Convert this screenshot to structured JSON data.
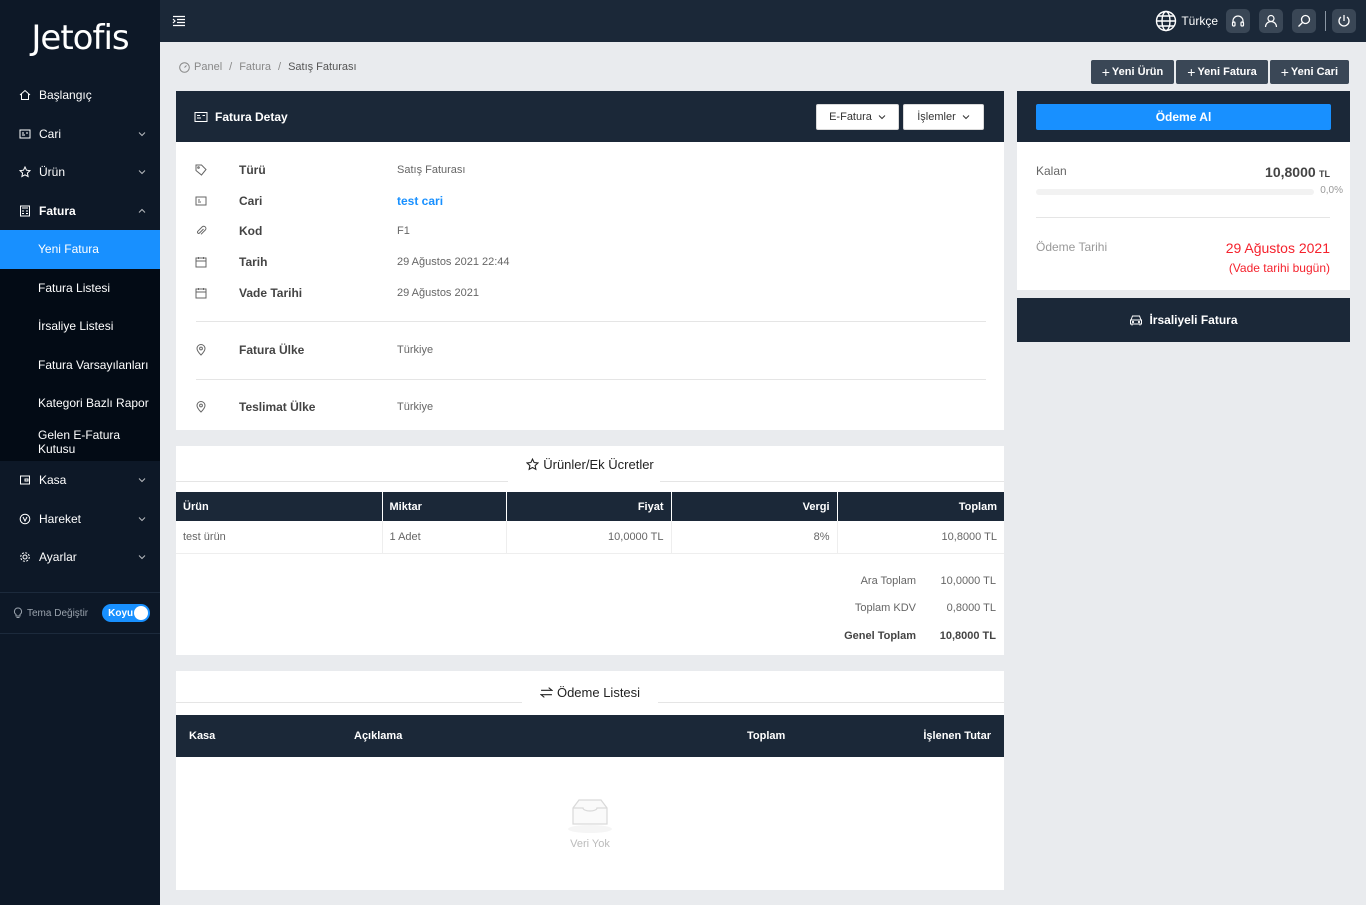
{
  "app": {
    "logo_text": "Jetofis"
  },
  "sidebar": {
    "items": [
      {
        "label": "Başlangıç",
        "icon": "home-icon"
      },
      {
        "label": "Cari",
        "icon": "id-card-icon"
      },
      {
        "label": "Ürün",
        "icon": "star-icon"
      },
      {
        "label": "Fatura",
        "icon": "calculator-icon"
      },
      {
        "label": "Kasa",
        "icon": "wallet-icon"
      },
      {
        "label": "Hareket",
        "icon": "vector-icon"
      },
      {
        "label": "Ayarlar",
        "icon": "gear-icon"
      }
    ],
    "fatura_sub": [
      {
        "label": "Yeni Fatura",
        "active": true
      },
      {
        "label": "Fatura Listesi"
      },
      {
        "label": "İrsaliye Listesi"
      },
      {
        "label": "Fatura Varsayılanları"
      },
      {
        "label": "Kategori Bazlı Rapor"
      },
      {
        "label": "Gelen E-Fatura Kutusu"
      }
    ],
    "theme_label": "Tema Değiştir",
    "theme_toggle": "Koyu"
  },
  "topbar": {
    "language": "Türkçe"
  },
  "breadcrumb": [
    "Panel",
    "Fatura",
    "Satış Faturası"
  ],
  "actions": [
    "Yeni Ürün",
    "Yeni Fatura",
    "Yeni Cari"
  ],
  "detail": {
    "title": "Fatura Detay",
    "btn_efatura": "E-Fatura",
    "btn_islemler": "İşlemler",
    "rows": [
      {
        "label": "Türü",
        "value": "Satış Faturası"
      },
      {
        "label": "Cari",
        "value": "test cari"
      },
      {
        "label": "Kod",
        "value": "F1"
      },
      {
        "label": "Tarih",
        "value": "29 Ağustos 2021 22:44"
      },
      {
        "label": "Vade Tarihi",
        "value": "29 Ağustos 2021"
      },
      {
        "label": "Fatura Ülke",
        "value": "Türkiye"
      },
      {
        "label": "Teslimat Ülke",
        "value": "Türkiye"
      }
    ]
  },
  "products": {
    "title": "Ürünler/Ek Ücretler",
    "headers": [
      "Ürün",
      "Miktar",
      "Fiyat",
      "Vergi",
      "Toplam"
    ],
    "rows": [
      [
        "test ürün",
        "1 Adet",
        "10,0000 TL",
        "8%",
        "10,8000 TL"
      ]
    ],
    "totals": [
      {
        "label": "Ara Toplam",
        "value": "10,0000 TL"
      },
      {
        "label": "Toplam KDV",
        "value": "0,8000 TL"
      },
      {
        "label": "Genel Toplam",
        "value": "10,8000 TL"
      }
    ]
  },
  "payments": {
    "title": "Ödeme Listesi",
    "headers": [
      "Kasa",
      "Açıklama",
      "Toplam",
      "İşlenen Tutar"
    ],
    "empty": "Veri Yok"
  },
  "payment_card": {
    "button": "Ödeme Al",
    "remaining_label": "Kalan",
    "remaining_value": "10,8000",
    "remaining_unit": "TL",
    "progress_text": "0,0%",
    "progress_fraction": 0,
    "due_label": "Ödeme Tarihi",
    "due_value": "29 Ağustos 2021",
    "due_note": "(Vade tarihi bugün)"
  },
  "waybill": {
    "label": "İrsaliyeli Fatura"
  },
  "colors": {
    "primary": "#1890ff",
    "dark": "#1b2838",
    "sidebar": "#0d1827",
    "danger": "#f5222d"
  }
}
